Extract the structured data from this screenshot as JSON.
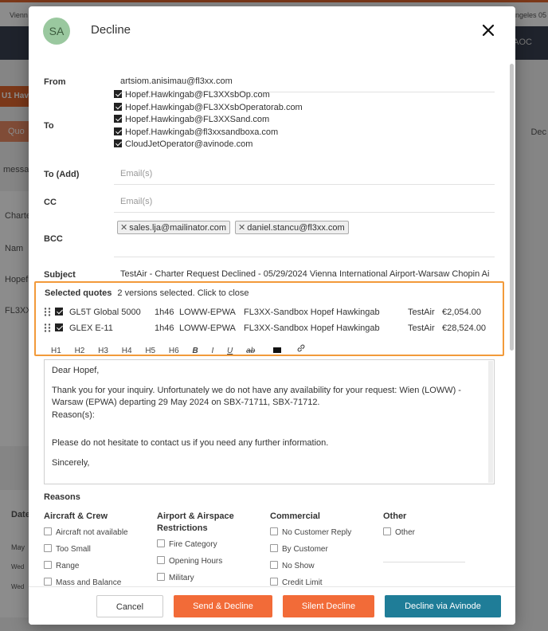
{
  "background": {
    "top_left": "Vienn",
    "top_right": "ngeles 05",
    "nav_right": "AOC",
    "tab_label": "U1 Hav",
    "button_label": "Quo",
    "right_tab": "Dec",
    "side_labels": [
      "messa",
      "Charte",
      "Nam",
      "Hopef",
      "FL3XX"
    ],
    "bottom_labels": [
      "Date",
      "May",
      "Wed",
      "Wed"
    ]
  },
  "modal": {
    "avatar_initials": "SA",
    "title": "Decline",
    "from_label": "From",
    "from_value": "artsiom.anisimau@fl3xx.com",
    "to_label": "To",
    "to_recipients": [
      "Hopef.Hawkingab@FL3XXsbOp.com",
      "Hopef.Hawkingab@FL3XXsbOperatorab.com",
      "Hopef.Hawkingab@FL3XXSand.com",
      "Hopef.Hawkingab@fl3xxsandboxa.com",
      "CloudJetOperator@avinode.com"
    ],
    "to_add_label": "To (Add)",
    "to_add_placeholder": "Email(s)",
    "cc_label": "CC",
    "cc_placeholder": "Email(s)",
    "bcc_label": "BCC",
    "bcc_tags": [
      "sales.lja@mailinator.com",
      "daniel.stancu@fl3xx.com"
    ],
    "subject_label": "Subject",
    "subject_value": "TestAir - Charter Request Declined -  05/29/2024 Vienna International Airport-Warsaw Chopin Ai",
    "selected_quotes": {
      "label": "Selected quotes",
      "summary": "2 versions selected. Click to close",
      "rows": [
        {
          "aircraft": "GL5T Global 5000",
          "duration": "1h46",
          "route": "LOWW-EPWA",
          "operator": "FL3XX-Sandbox Hopef Hawkingab",
          "company": "TestAir",
          "price": "€2,054.00"
        },
        {
          "aircraft": "GLEX E-11",
          "duration": "1h46",
          "route": "LOWW-EPWA",
          "operator": "FL3XX-Sandbox Hopef Hawkingab",
          "company": "TestAir",
          "price": "€28,524.00"
        }
      ]
    },
    "toolbar": {
      "h1": "H1",
      "h2": "H2",
      "h3": "H3",
      "h4": "H4",
      "h5": "H5",
      "h6": "H6",
      "bold": "B",
      "italic": "I",
      "underline": "U",
      "strike": "ab"
    },
    "editor": {
      "greeting": "Dear Hopef,",
      "line1": "Thank you for your inquiry. Unfortunately we do not have any availability for your request: Wien (LOWW) - Warsaw (EPWA) departing 29 May 2024 on SBX-71711, SBX-71712.",
      "line2": "Reason(s):",
      "line3": "Please do not hesitate to contact us if you need any further information.",
      "line4": "Sincerely,"
    },
    "reasons": {
      "title": "Reasons",
      "aircraft_crew": {
        "heading": "Aircraft & Crew",
        "items": [
          "Aircraft not available",
          "Too Small",
          "Range",
          "Mass and Balance"
        ]
      },
      "airport": {
        "heading": "Airport & Airspace Restrictions",
        "items": [
          "Fire Category",
          "Opening Hours",
          "Military"
        ]
      },
      "commercial": {
        "heading": "Commercial",
        "items": [
          "No Customer Reply",
          "By Customer",
          "No Show",
          "Credit Limit"
        ]
      },
      "other": {
        "heading": "Other",
        "items": [
          "Other"
        ]
      }
    },
    "footer": {
      "cancel": "Cancel",
      "send_decline": "Send & Decline",
      "silent_decline": "Silent Decline",
      "decline_avinode": "Decline via Avinode"
    }
  },
  "colors": {
    "primary_orange": "#f26b38",
    "avinode_blue": "#1f7d98",
    "highlight_border": "#f29a3a",
    "avatar_green": "#9ac89f"
  }
}
